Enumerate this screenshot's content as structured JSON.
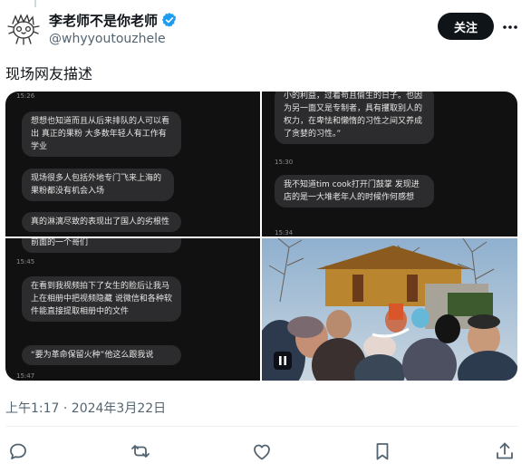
{
  "author": {
    "display_name": "李老师不是你老师",
    "handle": "@whyyoutouzhele",
    "follow_label": "关注"
  },
  "tweet": {
    "text": "现场网友描述",
    "timestamp": "上午1:17 · 2024年3月22日"
  },
  "media": {
    "panel1": {
      "time_top": "15:26",
      "messages": [
        "想想也知道而且从后来排队的人可以看出 真正的果粉 大多数年轻人有工作有学业",
        "现场很多人包括外地专门飞来上海的果粉都没有机会入场",
        "真的淋漓尽致的表现出了国人的劣根性"
      ]
    },
    "panel2": {
      "messages": [
        "小的利益，过着苟且偷生的日子。也因为另一面又是专制者，具有攫取别人的权力，在卑怯和懒惰的习性之间又养成了贪婪的习性。”",
        "我不知道tim cook打开门鼓掌 发现进店的是一大堆老年人的时候作何感想"
      ],
      "time_mid": "15:30",
      "time_bottom": "15:34"
    },
    "panel3": {
      "overlap_text": "前面的一个哥们",
      "time_top": "15:45",
      "messages": [
        "在看到我视频拍下了女生的脸后让我马上在相册中把视频隐藏 说微信和各种软件能直接提取相册中的文件",
        "“要为革命保留火种”他这么跟我说"
      ],
      "time_bottom": "15:47"
    }
  },
  "icons": {
    "verified": "verified-badge-icon",
    "more": "more-dots-icon",
    "reply": "reply-icon",
    "retweet": "retweet-icon",
    "like": "like-icon",
    "bookmark": "bookmark-icon",
    "share": "share-icon",
    "pause": "pause-icon"
  },
  "colors": {
    "verified": "#1d9bf0",
    "follow_bg": "#0f1419",
    "muted": "#536471"
  }
}
